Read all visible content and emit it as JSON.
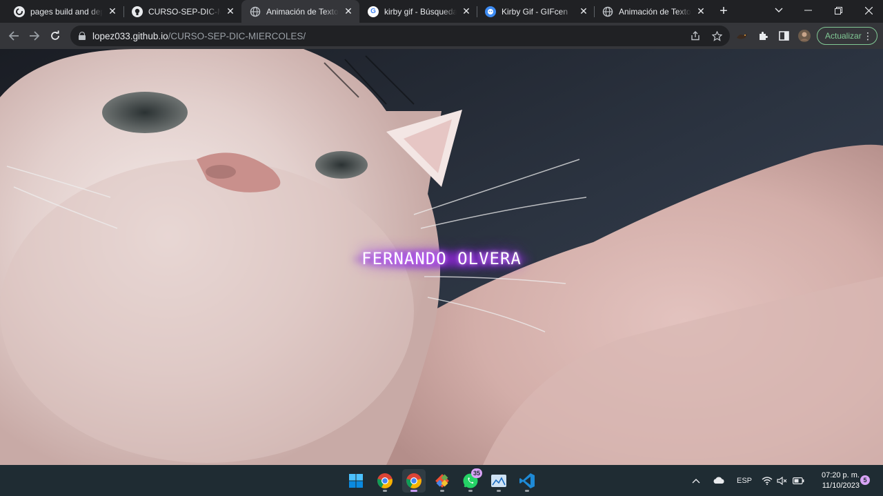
{
  "tabs": [
    {
      "title": "pages build and depl",
      "icon": "github-actions-icon",
      "active": false
    },
    {
      "title": "CURSO-SEP-DIC-MIE",
      "icon": "github-icon",
      "active": false
    },
    {
      "title": "Animación de Texto N",
      "icon": "globe-icon",
      "active": true
    },
    {
      "title": "kirby gif - Búsqueda",
      "icon": "google-icon",
      "active": false
    },
    {
      "title": "Kirby Gif - GIFcen",
      "icon": "gifcen-icon",
      "active": false
    },
    {
      "title": "Animación de Texto N",
      "icon": "globe-icon",
      "active": false
    }
  ],
  "address": {
    "host": "lopez033.github.io",
    "path": "/CURSO-SEP-DIC-MIERCOLES/"
  },
  "toolbar": {
    "update_label": "Actualizar"
  },
  "page": {
    "neon_text": "FERNANDO OLVERA"
  },
  "taskbar": {
    "whatsapp_badge": "35",
    "language": "ESP",
    "time": "07:20 p. m.",
    "date": "11/10/2023",
    "notifications": "5"
  },
  "colors": {
    "neon_glow": "#a640ff",
    "update_accent": "#81c995",
    "taskbar_bg": "#1f2c33",
    "chrome_bg": "#202124"
  }
}
